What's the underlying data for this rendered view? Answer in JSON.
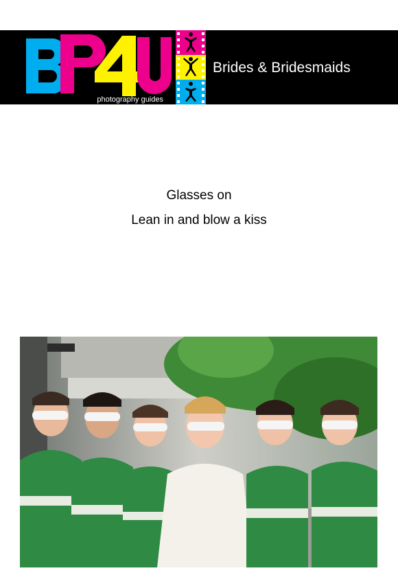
{
  "header": {
    "logo_text": "BP4U",
    "logo_tagline": "photography guides",
    "title": "Brides & Bridesmaids"
  },
  "instructions": {
    "line1": "Glasses on",
    "line2": "Lean in and blow a kiss"
  },
  "colors": {
    "background": "#ffffff",
    "header_bg": "#000000",
    "logo_cyan": "#00aeef",
    "logo_magenta": "#ec008c",
    "logo_yellow": "#fff200",
    "dress_green": "#2f8a43"
  },
  "photo": {
    "subject_count": 6
  }
}
